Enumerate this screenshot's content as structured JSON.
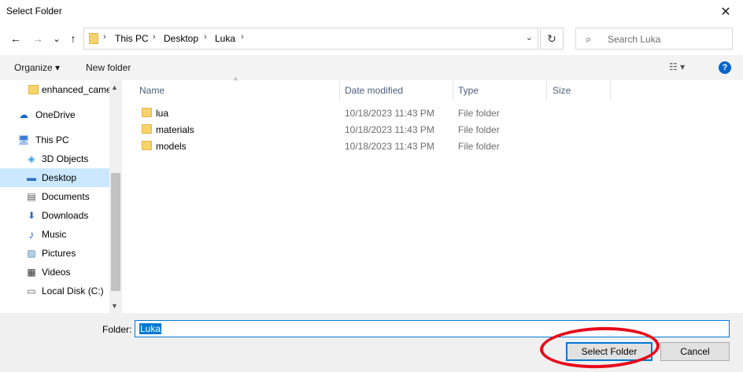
{
  "window": {
    "title": "Select Folder",
    "close_glyph": "✕"
  },
  "nav": {
    "back_glyph": "←",
    "forward_glyph": "→",
    "recent_glyph": "⌄",
    "up_glyph": "↑",
    "breadcrumbs": [
      "This PC",
      "Desktop",
      "Luka"
    ],
    "separator": "›",
    "dropdown_glyph": "⌄",
    "refresh_glyph": "↻",
    "search_placeholder": "Search Luka",
    "search_glyph": "⌕"
  },
  "toolbar": {
    "organize": "Organize ▾",
    "new_folder": "New folder",
    "view_glyph": "☷ ▾",
    "help_glyph": "?"
  },
  "sidebar": {
    "items": [
      {
        "label": "enhanced_came",
        "icon": "folder-icon",
        "glyph": ""
      },
      {
        "label": "OneDrive",
        "icon": "cloud-icon",
        "glyph": "☁"
      },
      {
        "label": "This PC",
        "icon": "computer-icon",
        "glyph": "🖥"
      },
      {
        "label": "3D Objects",
        "icon": "cube-icon",
        "glyph": "◈"
      },
      {
        "label": "Desktop",
        "icon": "desktop-icon",
        "glyph": "▬"
      },
      {
        "label": "Documents",
        "icon": "document-icon",
        "glyph": "▤"
      },
      {
        "label": "Downloads",
        "icon": "download-icon",
        "glyph": "⬇"
      },
      {
        "label": "Music",
        "icon": "music-icon",
        "glyph": "♪"
      },
      {
        "label": "Pictures",
        "icon": "picture-icon",
        "glyph": "▨"
      },
      {
        "label": "Videos",
        "icon": "video-icon",
        "glyph": "▦"
      },
      {
        "label": "Local Disk (C:)",
        "icon": "disk-icon",
        "glyph": "▭"
      }
    ],
    "selected": "Desktop",
    "scroll_up_glyph": "▲",
    "scroll_down_glyph": "▼"
  },
  "table": {
    "columns": [
      "Name",
      "Date modified",
      "Type",
      "Size"
    ],
    "sort_glyph": "^",
    "rows": [
      {
        "name": "lua",
        "date": "10/18/2023 11:43 PM",
        "type": "File folder"
      },
      {
        "name": "materials",
        "date": "10/18/2023 11:43 PM",
        "type": "File folder"
      },
      {
        "name": "models",
        "date": "10/18/2023 11:43 PM",
        "type": "File folder"
      }
    ]
  },
  "footer": {
    "folder_label": "Folder:",
    "folder_value": "Luka",
    "select_button": "Select Folder",
    "cancel_button": "Cancel"
  },
  "colors": {
    "accent": "#0078d7",
    "highlight_circle": "#e8091a",
    "selected_nav": "#cce8ff"
  }
}
